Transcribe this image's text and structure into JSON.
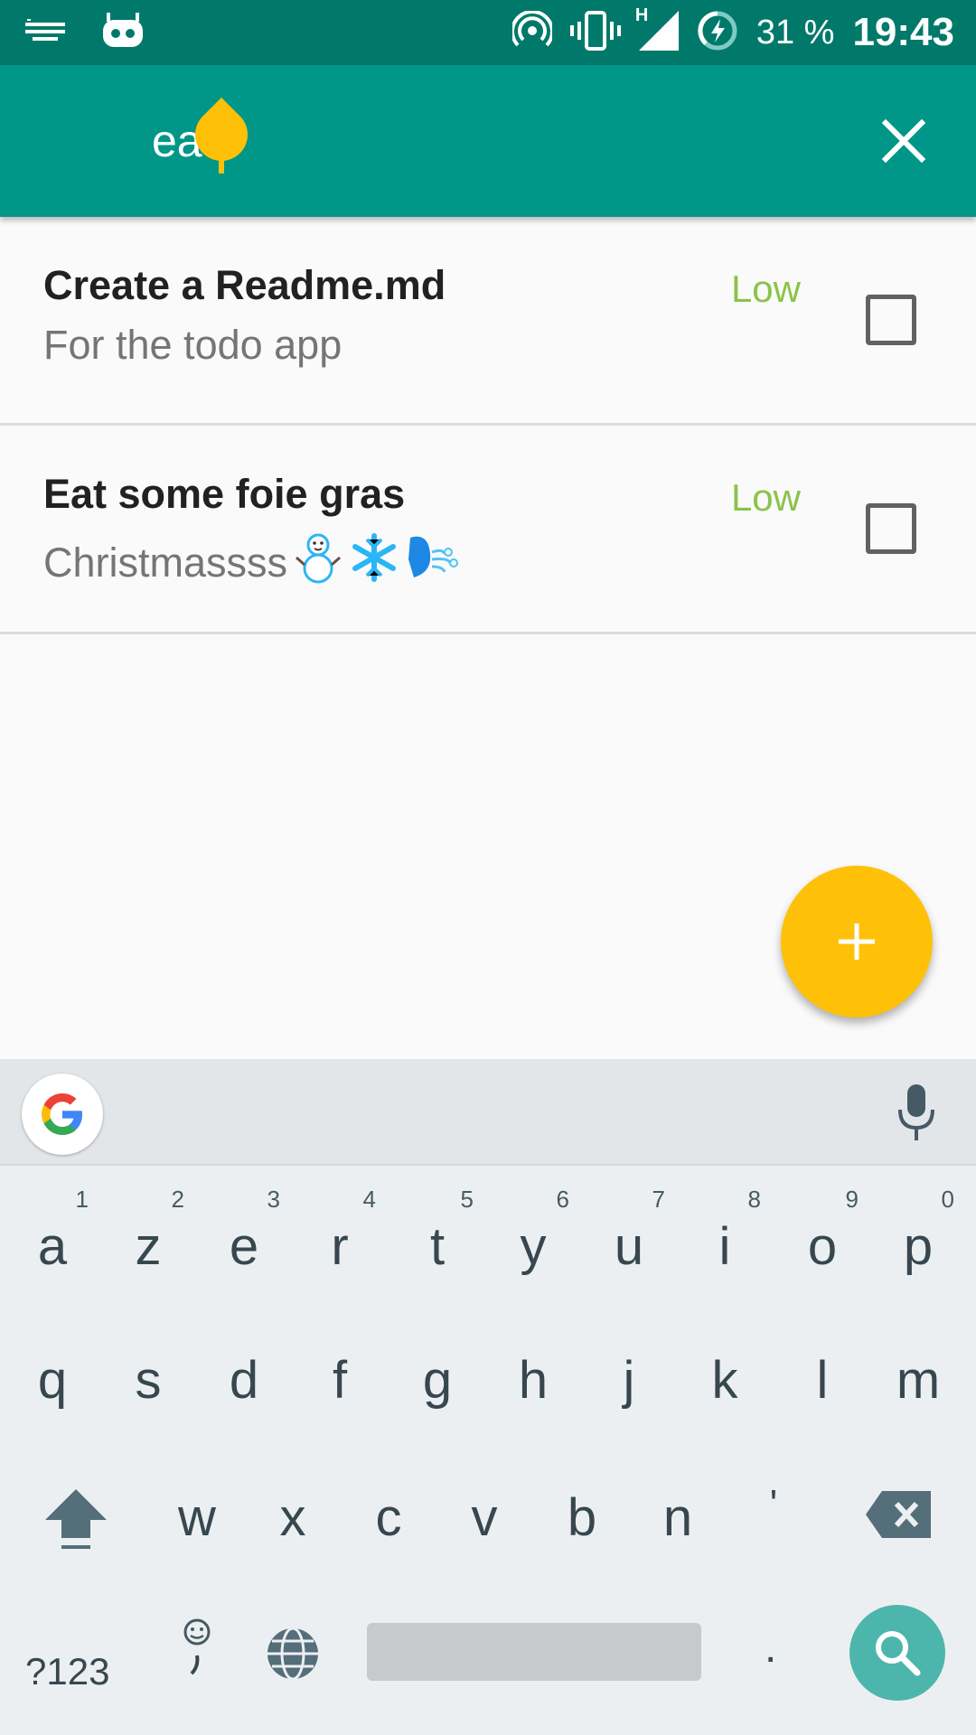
{
  "status_bar": {
    "battery": "31 %",
    "time": "19:43",
    "network_type": "H"
  },
  "search": {
    "query": "eat",
    "placeholder": ""
  },
  "todos": [
    {
      "title": "Create a Readme.md",
      "description": "For the todo app",
      "priority": "Low",
      "checked": false
    },
    {
      "title": "Eat some foie gras",
      "description": "Christmassss",
      "description_emoji": [
        "snowman",
        "snowflake",
        "wind-blowing-face"
      ],
      "priority": "Low",
      "checked": false
    }
  ],
  "keyboard": {
    "row1": [
      {
        "ch": "a",
        "hint": "1"
      },
      {
        "ch": "z",
        "hint": "2"
      },
      {
        "ch": "e",
        "hint": "3"
      },
      {
        "ch": "r",
        "hint": "4"
      },
      {
        "ch": "t",
        "hint": "5"
      },
      {
        "ch": "y",
        "hint": "6"
      },
      {
        "ch": "u",
        "hint": "7"
      },
      {
        "ch": "i",
        "hint": "8"
      },
      {
        "ch": "o",
        "hint": "9"
      },
      {
        "ch": "p",
        "hint": "0"
      }
    ],
    "row2": [
      "q",
      "s",
      "d",
      "f",
      "g",
      "h",
      "j",
      "k",
      "l",
      "m"
    ],
    "row3": [
      "w",
      "x",
      "c",
      "v",
      "b",
      "n",
      "'"
    ],
    "symbols_label": "?123",
    "period": "."
  },
  "colors": {
    "primary": "#009688",
    "primary_dark": "#00796b",
    "accent": "#ffc107",
    "priority_low": "#8bc34a"
  }
}
